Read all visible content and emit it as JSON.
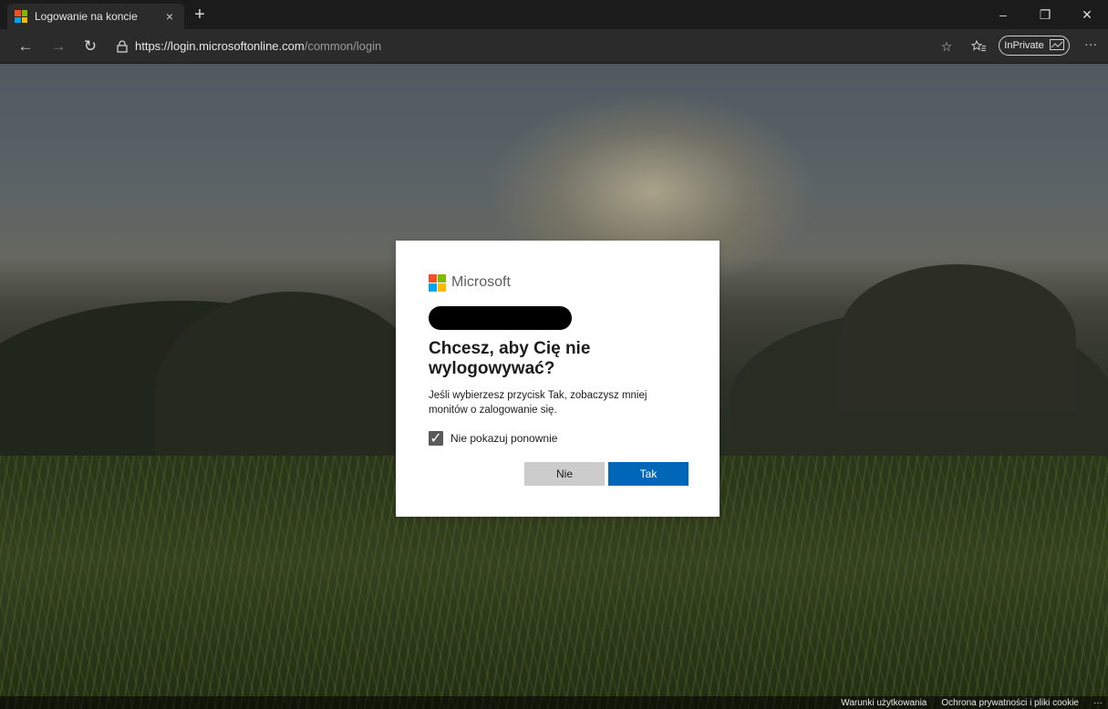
{
  "browser": {
    "tab": {
      "title": "Logowanie na koncie",
      "close": "×"
    },
    "new_tab": "+",
    "window_controls": {
      "minimize": "–",
      "restore": "❐",
      "close": "✕"
    },
    "nav": {
      "back": "←",
      "forward": "→",
      "refresh": "↻"
    },
    "address": {
      "url_main": "https://login.microsoftonline.com",
      "url_rest": "/common/login"
    },
    "toolbar": {
      "favorite": "☆",
      "favorites_list": "☆",
      "inprivate_label": "InPrivate",
      "more": "···"
    }
  },
  "dialog": {
    "brand": "Microsoft",
    "title": "Chcesz, aby Cię nie wylogowywać?",
    "description": "Jeśli wybierzesz przycisk Tak, zobaczysz mniej monitów o zalogowanie się.",
    "checkbox": {
      "label": "Nie pokazuj ponownie",
      "checked": true,
      "mark": "✓"
    },
    "buttons": {
      "no": "Nie",
      "yes": "Tak"
    },
    "colors": {
      "primary": "#0067b8",
      "secondary": "#cccccc"
    }
  },
  "footer": {
    "terms": "Warunki użytkowania",
    "privacy": "Ochrona prywatności i pliki cookie",
    "more": "···"
  },
  "brand_colors": [
    "#f25022",
    "#7fba00",
    "#00a4ef",
    "#ffb900"
  ]
}
